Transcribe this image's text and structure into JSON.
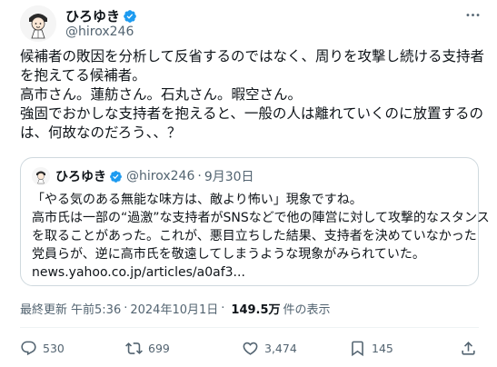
{
  "author": {
    "name": "ひろゆき",
    "handle": "@hirox246"
  },
  "post": {
    "lines": [
      "候補者の敗因を分析して反省するのではなく、周りを攻撃し続ける支持者",
      "を抱えてる候補者。",
      "高市さん。蓮舫さん。石丸さん。暇空さん。",
      "強固でおかしな支持者を抱えると、一般の人は離れていくのに放置するの",
      "は、何故なのだろう、、？"
    ]
  },
  "quote": {
    "name": "ひろゆき",
    "handle": "@hirox246",
    "dot": "·",
    "date": "9月30日",
    "lines": [
      "「やる気のある無能な味方は、敵より怖い」現象ですね。",
      "高市氏は一部の“過激”な支持者がSNSなどで他の陣営に対して攻撃的なスタンス",
      "を取ることがあった。これが、悪目立ちした結果、支持者を決めていなかった",
      "党員らが、逆に高市氏を敬遠してしまうような現象がみられていた。",
      "news.yahoo.co.jp/articles/a0af3..."
    ]
  },
  "meta": {
    "updated_label": "最終更新",
    "time": "午前5:36",
    "sep": "·",
    "date": "2024年10月1日",
    "views_count": "149.5万",
    "views_label": "件の表示"
  },
  "actions": {
    "replies": "530",
    "reposts": "699",
    "likes": "3,474",
    "bookmarks": "145"
  },
  "icons": {
    "verified": "verified-badge-icon",
    "more": "more-icon",
    "reply": "reply-icon",
    "repost": "repost-icon",
    "like": "heart-icon",
    "bookmark": "bookmark-icon",
    "share": "share-icon"
  },
  "colors": {
    "verified": "#1d9bf0",
    "muted": "#536471",
    "text": "#0f1419",
    "border": "#cfd9de"
  }
}
